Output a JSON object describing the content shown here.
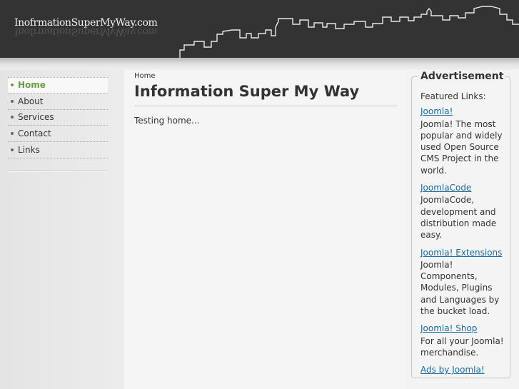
{
  "header": {
    "logo_text": "InofrmationSuperMyWay.com"
  },
  "menu": {
    "items": [
      {
        "label": "Home",
        "active": true
      },
      {
        "label": "About",
        "active": false
      },
      {
        "label": "Services",
        "active": false
      },
      {
        "label": "Contact",
        "active": false
      },
      {
        "label": "Links",
        "active": false
      }
    ]
  },
  "main": {
    "breadcrumb": "Home",
    "title": "Information Super My Way",
    "body": "Testing home..."
  },
  "advertisement": {
    "heading": "Advertisement",
    "intro": "Featured Links:",
    "items": [
      {
        "link": "Joomla!",
        "text": "Joomla! The most popular and widely used Open Source CMS Project in the world."
      },
      {
        "link": "JoomlaCode",
        "text": "JoomlaCode, development and distribution made easy."
      },
      {
        "link": "Joomla! Extensions",
        "text": "Joomla! Components, Modules, Plugins and Languages by the bucket load."
      },
      {
        "link": "Joomla! Shop",
        "text": "For all your Joomla! merchandise."
      }
    ],
    "footer_link": "Ads by Joomla!"
  },
  "colors": {
    "header_bg": "#333333",
    "active_menu": "#6a9d4a",
    "link": "#1a6a9a"
  }
}
